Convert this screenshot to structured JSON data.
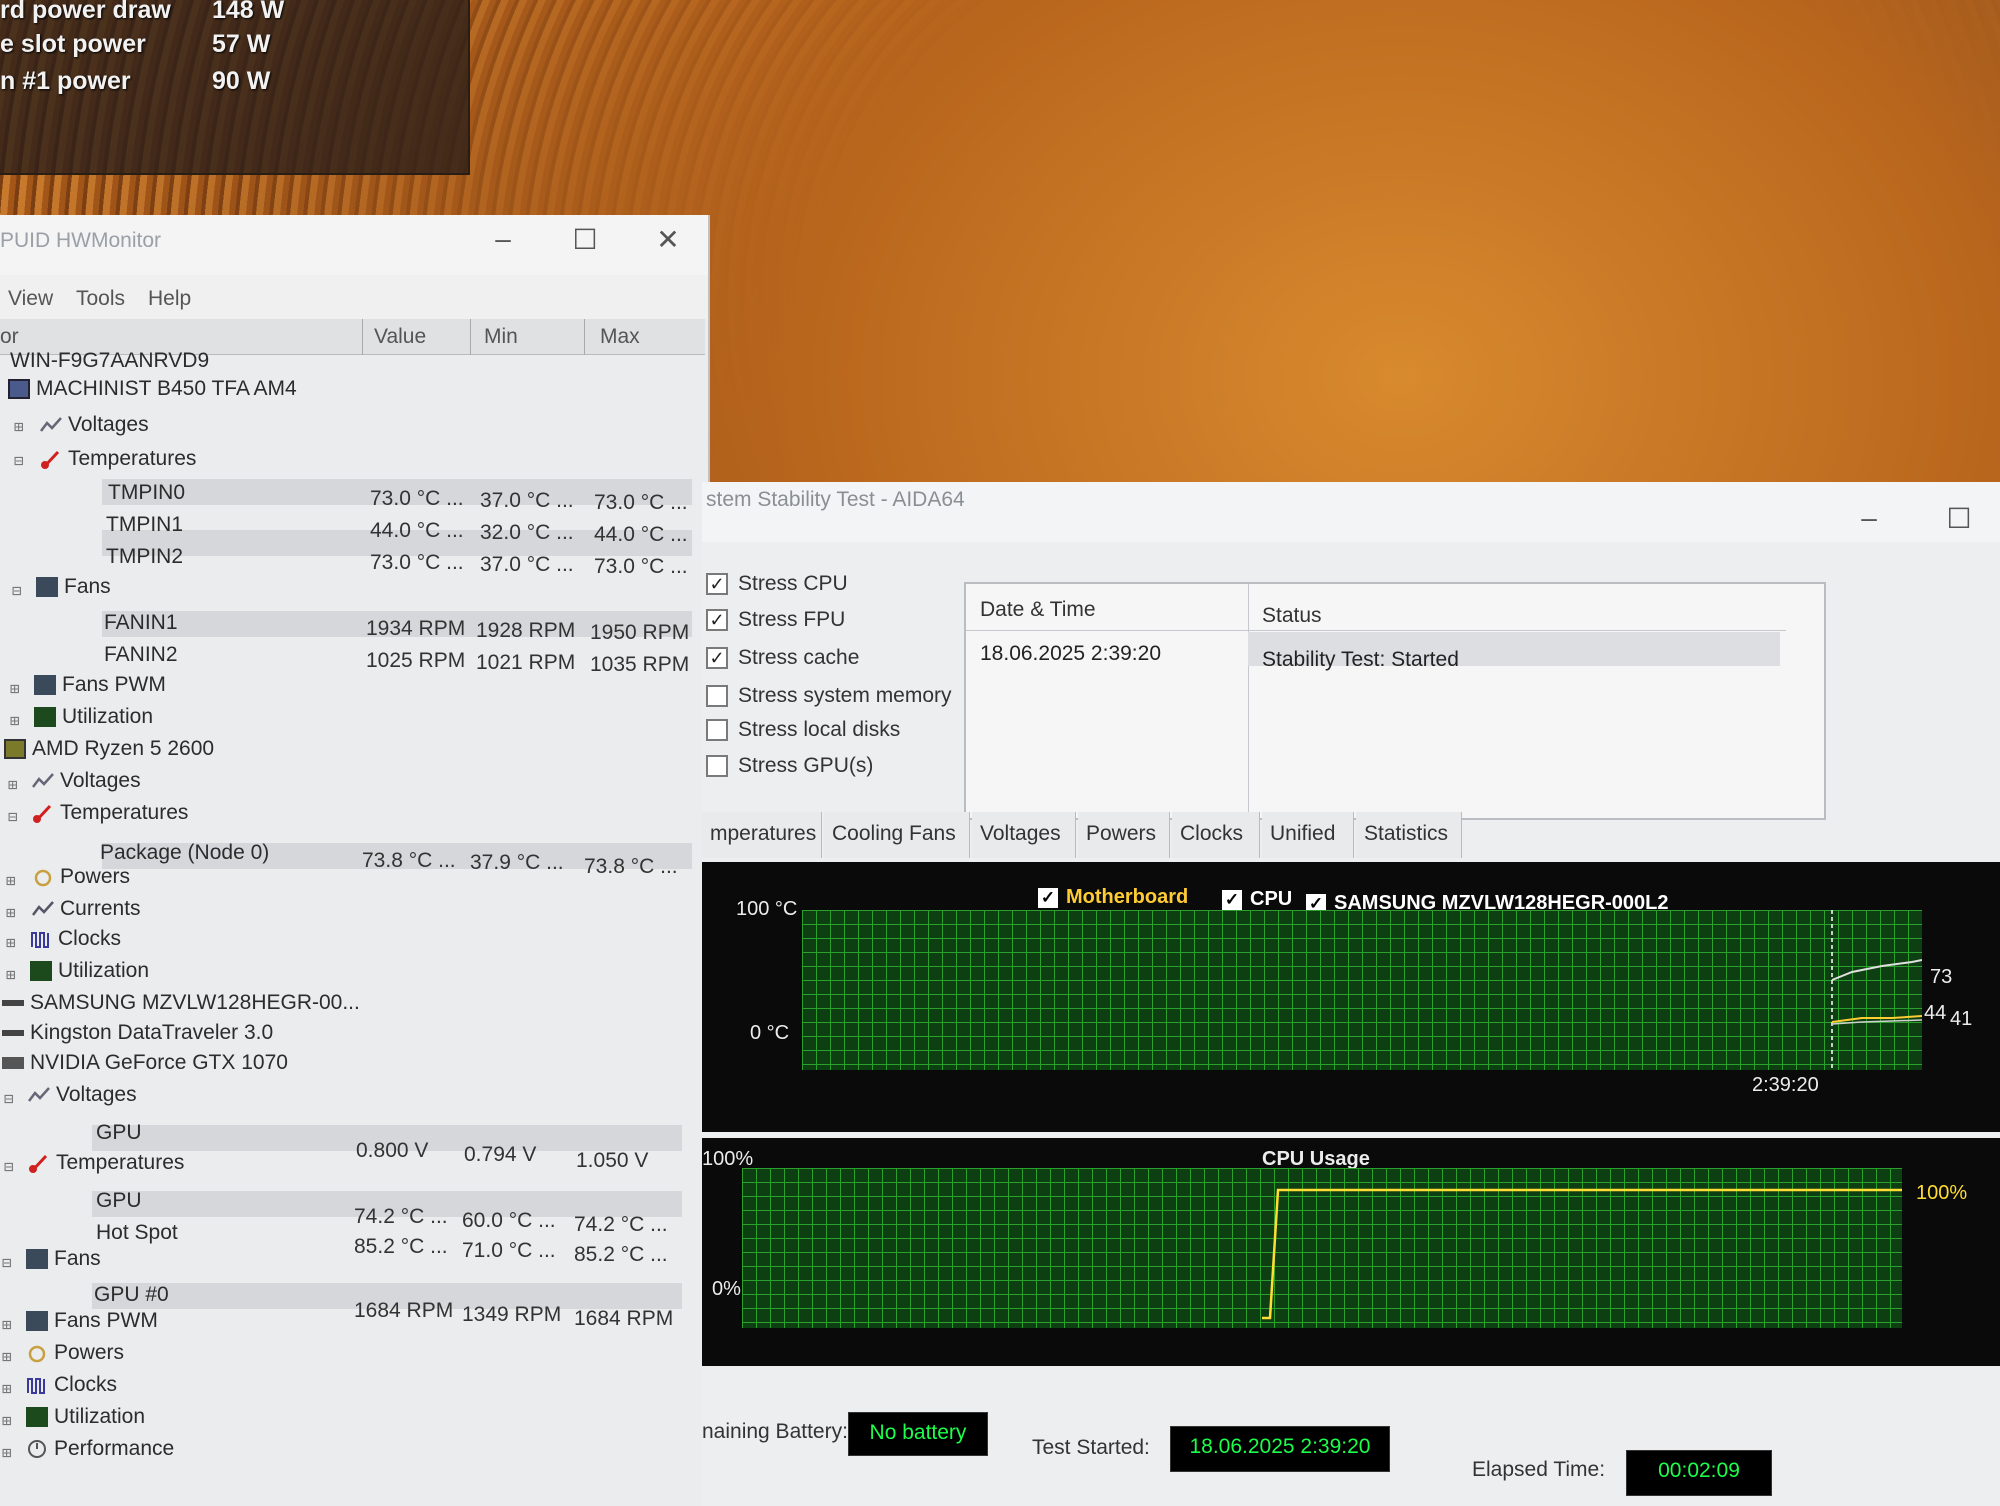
{
  "osd": {
    "rows": [
      {
        "label": "rd power draw",
        "value": "148 W"
      },
      {
        "label": "e slot power",
        "value": "57 W"
      },
      {
        "label": "n #1 power",
        "value": "90 W"
      }
    ]
  },
  "hwmonitor": {
    "title": "PUID HWMonitor",
    "menu": [
      "View",
      "Tools",
      "Help"
    ],
    "columns": [
      "or",
      "Value",
      "Min",
      "Max"
    ],
    "tree": {
      "host": "WIN-F9G7AANRVD9",
      "mb": "MACHINIST B450 TFA AM4",
      "mb_voltages": "Voltages",
      "mb_temps": "Temperatures",
      "tmpin0": {
        "name": "TMPIN0",
        "value": "73.0 °C ...",
        "min": "37.0 °C ...",
        "max": "73.0 °C ..."
      },
      "tmpin1": {
        "name": "TMPIN1",
        "value": "44.0 °C ...",
        "min": "32.0 °C ...",
        "max": "44.0 °C ..."
      },
      "tmpin2": {
        "name": "TMPIN2",
        "value": "73.0 °C ...",
        "min": "37.0 °C ...",
        "max": "73.0 °C ..."
      },
      "mb_fans": "Fans",
      "fanin1": {
        "name": "FANIN1",
        "value": "1934 RPM",
        "min": "1928 RPM",
        "max": "1950 RPM"
      },
      "fanin2": {
        "name": "FANIN2",
        "value": "1025 RPM",
        "min": "1021 RPM",
        "max": "1035 RPM"
      },
      "mb_fanspwm": "Fans PWM",
      "mb_util": "Utilization",
      "cpu": "AMD Ryzen 5 2600",
      "cpu_voltages": "Voltages",
      "cpu_temps": "Temperatures",
      "package": {
        "name": "Package (Node 0)",
        "value": "73.8 °C ...",
        "min": "37.9 °C ...",
        "max": "73.8 °C ..."
      },
      "cpu_powers": "Powers",
      "cpu_currents": "Currents",
      "cpu_clocks": "Clocks",
      "cpu_util": "Utilization",
      "ssd": "SAMSUNG MZVLW128HEGR-00...",
      "usb": "Kingston DataTraveler 3.0",
      "gpu": "NVIDIA GeForce GTX 1070",
      "gpu_voltages": "Voltages",
      "gpu_v": {
        "name": "GPU",
        "value": "0.800 V",
        "min": "0.794 V",
        "max": "1.050 V"
      },
      "gpu_temps": "Temperatures",
      "gpu_t": {
        "name": "GPU",
        "value": "74.2 °C ...",
        "min": "60.0 °C ...",
        "max": "74.2 °C ..."
      },
      "hotspot": {
        "name": "Hot Spot",
        "value": "85.2 °C ...",
        "min": "71.0 °C ...",
        "max": "85.2 °C ..."
      },
      "gpu_fans": "Fans",
      "gpu0": {
        "name": "GPU #0",
        "value": "1684 RPM",
        "min": "1349 RPM",
        "max": "1684 RPM"
      },
      "gpu_fanspwm": "Fans PWM",
      "gpu_powers": "Powers",
      "gpu_clocks": "Clocks",
      "gpu_util": "Utilization",
      "gpu_perf": "Performance"
    }
  },
  "aida": {
    "title": "stem Stability Test - AIDA64",
    "checks": [
      {
        "label": "Stress CPU",
        "checked": true
      },
      {
        "label": "Stress FPU",
        "checked": true
      },
      {
        "label": "Stress cache",
        "checked": true
      },
      {
        "label": "Stress system memory",
        "checked": false
      },
      {
        "label": "Stress local disks",
        "checked": false
      },
      {
        "label": "Stress GPU(s)",
        "checked": false
      }
    ],
    "log": {
      "col_datetime": "Date & Time",
      "col_status": "Status",
      "row_datetime": "18.06.2025 2:39:20",
      "row_status": "Stability Test: Started"
    },
    "tabs": [
      "mperatures",
      "Cooling Fans",
      "Voltages",
      "Powers",
      "Clocks",
      "Unified",
      "Statistics"
    ],
    "temp_graph": {
      "legend": [
        {
          "label": "Motherboard",
          "color": "#ffcc33"
        },
        {
          "label": "CPU",
          "color": "#ffffff"
        },
        {
          "label": "SAMSUNG MZVLW128HEGR-000L2",
          "color": "#ffffff"
        }
      ],
      "y_top": "100 °C",
      "y_bottom": "0 °C",
      "time": "2:39:20",
      "val_a": "73",
      "val_b": "44",
      "val_c": "41"
    },
    "cpu_graph": {
      "title": "CPU Usage",
      "y_top": "100%",
      "y_bottom": "0%",
      "value_label": "100%"
    },
    "footer": {
      "battery_label": "naining Battery:",
      "battery_value": "No battery",
      "started_label": "Test Started:",
      "started_value": "18.06.2025 2:39:20",
      "elapsed_label": "Elapsed Time:",
      "elapsed_value": "00:02:09"
    }
  }
}
